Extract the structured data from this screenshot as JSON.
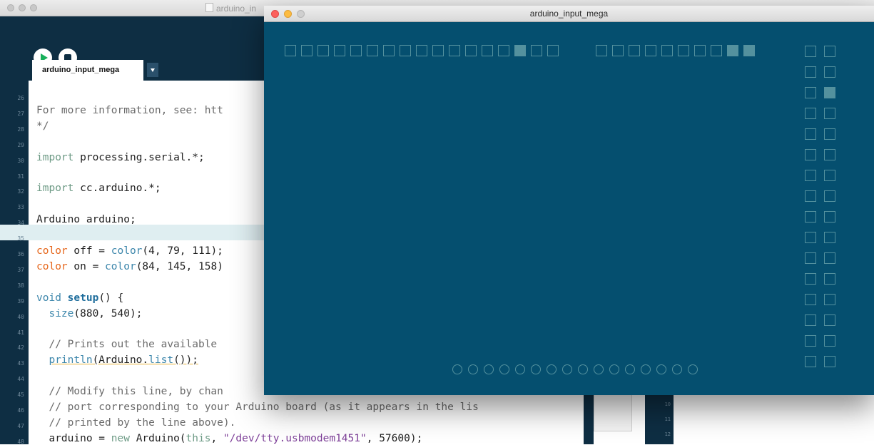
{
  "ide": {
    "title": "arduino_in",
    "tab_label": "arduino_input_mega",
    "code_lines": [
      {
        "n": "26",
        "segs": []
      },
      {
        "n": "27",
        "segs": [
          {
            "t": "For more information, see: htt",
            "c": "k-cmt"
          }
        ]
      },
      {
        "n": "28",
        "segs": [
          {
            "t": "*/",
            "c": "k-cmt"
          }
        ]
      },
      {
        "n": "29",
        "segs": []
      },
      {
        "n": "30",
        "segs": [
          {
            "t": "import",
            "c": "k-imp"
          },
          {
            "t": " processing.serial.*;"
          }
        ]
      },
      {
        "n": "31",
        "segs": []
      },
      {
        "n": "32",
        "segs": [
          {
            "t": "import",
            "c": "k-imp"
          },
          {
            "t": " cc.arduino.*;"
          }
        ]
      },
      {
        "n": "33",
        "segs": []
      },
      {
        "n": "34",
        "segs": [
          {
            "t": "Arduino arduino;"
          }
        ]
      },
      {
        "n": "35",
        "segs": []
      },
      {
        "n": "36",
        "segs": [
          {
            "t": "color",
            "c": "k-type"
          },
          {
            "t": " off = "
          },
          {
            "t": "color",
            "c": "k-fn"
          },
          {
            "t": "(4, 79, 111);"
          }
        ]
      },
      {
        "n": "37",
        "segs": [
          {
            "t": "color",
            "c": "k-type"
          },
          {
            "t": " on = "
          },
          {
            "t": "color",
            "c": "k-fn"
          },
          {
            "t": "(84, 145, 158)"
          }
        ]
      },
      {
        "n": "38",
        "segs": []
      },
      {
        "n": "39",
        "segs": [
          {
            "t": "void",
            "c": "k-fn"
          },
          {
            "t": " "
          },
          {
            "t": "setup",
            "c": "k-bold"
          },
          {
            "t": "() {"
          }
        ]
      },
      {
        "n": "40",
        "segs": [
          {
            "t": "  "
          },
          {
            "t": "size",
            "c": "k-fn"
          },
          {
            "t": "(880, 540);"
          }
        ]
      },
      {
        "n": "41",
        "segs": []
      },
      {
        "n": "42",
        "segs": [
          {
            "t": "  // Prints out the available",
            "c": "k-cmt"
          }
        ]
      },
      {
        "n": "43",
        "segs": [
          {
            "t": "  "
          },
          {
            "t": "println",
            "c": "k-fn uline"
          },
          {
            "t": "(Arduino.",
            "c": "uline"
          },
          {
            "t": "list",
            "c": "k-fn uline"
          },
          {
            "t": "());",
            "c": "uline"
          }
        ]
      },
      {
        "n": "44",
        "segs": []
      },
      {
        "n": "45",
        "segs": [
          {
            "t": "  // Modify this line, by chan",
            "c": "k-cmt"
          }
        ]
      },
      {
        "n": "46",
        "segs": [
          {
            "t": "  // port corresponding to your Arduino board (as it appears in the lis",
            "c": "k-cmt"
          }
        ]
      },
      {
        "n": "47",
        "segs": [
          {
            "t": "  // printed by the line above).",
            "c": "k-cmt"
          }
        ]
      },
      {
        "n": "48",
        "segs": [
          {
            "t": "  arduino = "
          },
          {
            "t": "new",
            "c": "k-new"
          },
          {
            "t": " Arduino("
          },
          {
            "t": "this",
            "c": "k-new"
          },
          {
            "t": ", "
          },
          {
            "t": "\"/dev/tty.usbmodem1451\"",
            "c": "k-str"
          },
          {
            "t": ", 57600);"
          }
        ]
      }
    ],
    "console_line_numbers": [
      "10",
      "11",
      "12"
    ]
  },
  "sketch": {
    "title": "arduino_input_mega",
    "colors": {
      "off": "#054f6f",
      "on": "#54919e"
    },
    "top_left_pins": [
      0,
      0,
      0,
      0,
      0,
      0,
      0,
      0,
      0,
      0,
      0,
      0,
      0,
      0,
      1,
      0,
      0
    ],
    "top_right_pins": [
      0,
      0,
      0,
      0,
      0,
      0,
      0,
      0,
      1,
      1
    ],
    "side_pins": [
      [
        0,
        0
      ],
      [
        0,
        0
      ],
      [
        0,
        1
      ],
      [
        0,
        0
      ],
      [
        0,
        0
      ],
      [
        0,
        0
      ],
      [
        0,
        0
      ],
      [
        0,
        0
      ],
      [
        0,
        0
      ],
      [
        0,
        0
      ],
      [
        0,
        0
      ],
      [
        0,
        0
      ],
      [
        0,
        0
      ],
      [
        0,
        0
      ],
      [
        0,
        0
      ],
      [
        0,
        0
      ]
    ],
    "analog_pins": 16
  }
}
